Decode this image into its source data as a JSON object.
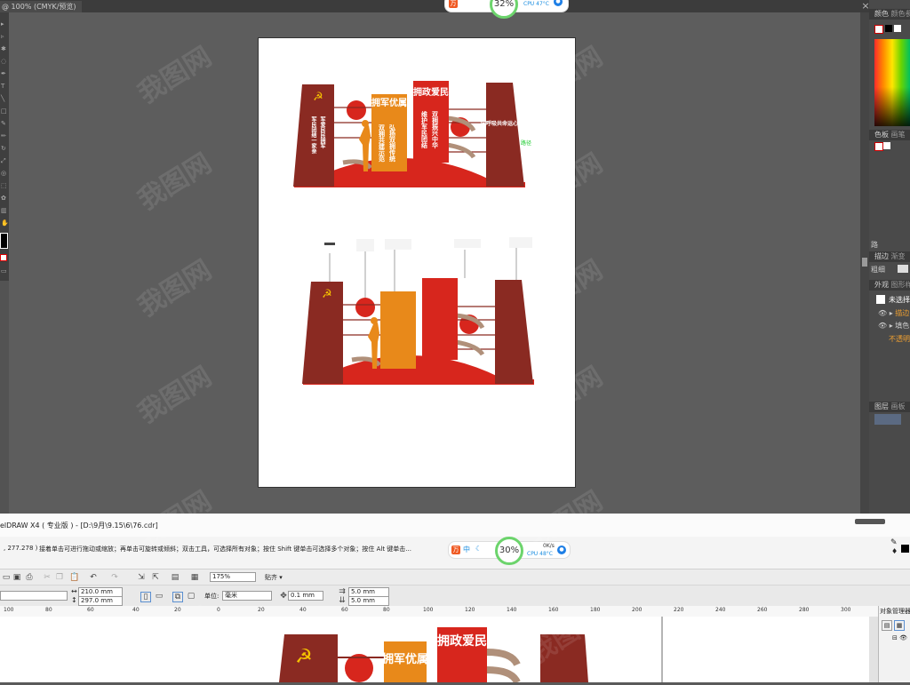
{
  "ai": {
    "tab_label": "@ 100% (CMYK/预览)",
    "close_symbol": "×",
    "panels": {
      "color_tab": "颜色",
      "color_tab2": "颜色参考",
      "swatches_tab": "色板",
      "brushes_tab": "画笔",
      "stroke_tab": "描边",
      "gradient_tab": "渐变",
      "weight_label": "粗细",
      "appearance_tab": "外观",
      "graphic_styles_tab": "图形样式",
      "unselected_label": "未选择",
      "stroke_row": "描边",
      "fill_row": "填色",
      "opacity_row": "不透明度",
      "layers_tab": "图层",
      "artboards_tab": "画板",
      "align_label": "路"
    },
    "artboard_note": "路径"
  },
  "design_top": {
    "party_slogan": "军民团结一家亲",
    "army_slogan": "军爱民民拥军",
    "block1_title": "拥军优属",
    "block1_sub": "双拥共建示范",
    "block1_sub2": "弘扬双拥传统",
    "block2_title": "拥政爱民",
    "block2_sub": "维护军民团结",
    "block2_sub2": "双拥振兴中华",
    "right_slogan": "同呼吸共命运心连心"
  },
  "cd": {
    "title": "elDRAW X4 ( 专业版 ) - [D:\\9月\\9.15\\6\\76.cdr]",
    "coord": ", 277.278 )",
    "hint": "接着单击可进行拖动或缩放；再单击可旋转或倾斜；双击工具，可选择所有对象；按住 Shift 键单击可选择多个对象；按住 Alt 键单击...",
    "zoom": "175%",
    "snap_label": "贴齐",
    "width": "210.0 mm",
    "height": "297.0 mm",
    "unit_label": "单位:",
    "unit_value": "毫米",
    "nudge": "0.1 mm",
    "dup_x": "5.0 mm",
    "dup_y": "5.0 mm",
    "docker_title": "对象管理器",
    "ruler_ticks": [
      "100",
      "80",
      "60",
      "40",
      "20",
      "0",
      "20",
      "40",
      "60",
      "80",
      "100",
      "120",
      "140",
      "160",
      "180",
      "200",
      "220",
      "240",
      "260",
      "280",
      "300"
    ]
  },
  "monitor_top": {
    "percent": "32%",
    "cpu_label": "CPU",
    "cpu_temp": "47°C"
  },
  "monitor_bottom": {
    "percent": "30%",
    "cpu_label": "CPU",
    "cpu_temp": "48°C",
    "net_speed": "0K/s",
    "ime_label": "中"
  },
  "watermark": "我图网"
}
